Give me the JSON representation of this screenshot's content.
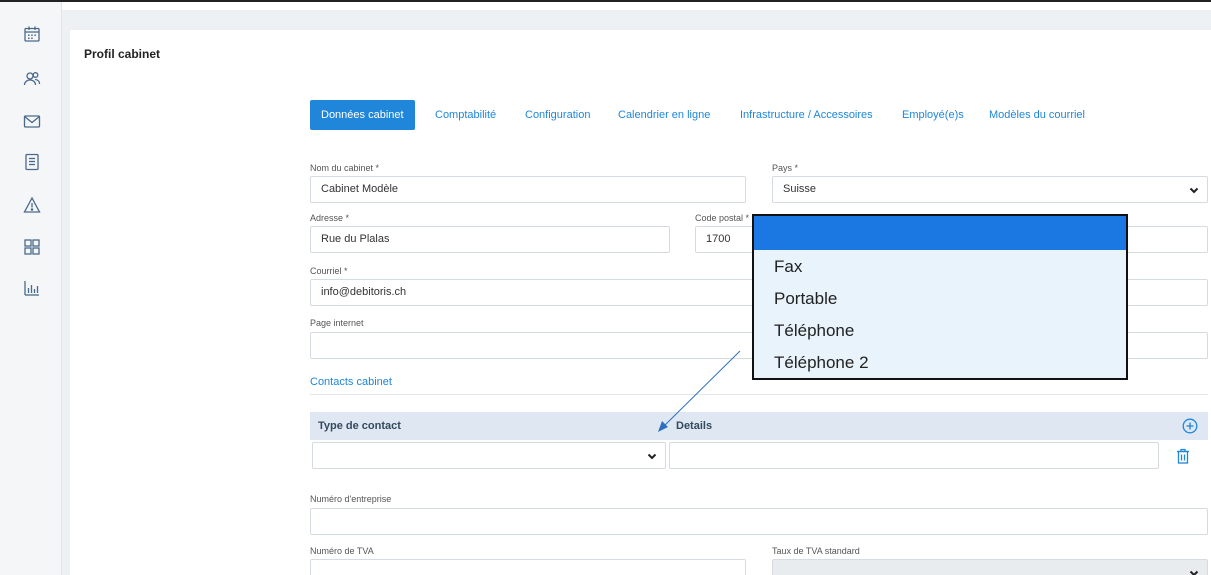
{
  "sidebar": {
    "icons": [
      "calendar-icon",
      "users-icon",
      "mail-icon",
      "document-icon",
      "warning-icon",
      "grid-icon",
      "chart-icon"
    ]
  },
  "page": {
    "title": "Profil cabinet"
  },
  "tabs": [
    {
      "label": "Données cabinet",
      "active": true
    },
    {
      "label": "Comptabilité",
      "active": false
    },
    {
      "label": "Configuration",
      "active": false
    },
    {
      "label": "Calendrier en ligne",
      "active": false
    },
    {
      "label": "Infrastructure / Accessoires",
      "active": false
    },
    {
      "label": "Employé(e)s",
      "active": false
    },
    {
      "label": "Modèles du courriel",
      "active": false
    }
  ],
  "form": {
    "nom_label": "Nom du cabinet *",
    "nom_value": "Cabinet Modèle",
    "pays_label": "Pays *",
    "pays_value": "Suisse",
    "adresse_label": "Adresse *",
    "adresse_value": "Rue du Plalas",
    "code_postal_label": "Code postal *",
    "code_postal_value": "1700",
    "courriel_label": "Courriel *",
    "courriel_value": "info@debitoris.ch",
    "page_internet_label": "Page internet",
    "page_internet_value": "",
    "contacts_title": "Contacts cabinet",
    "numero_entreprise_label": "Numéro d'entreprise",
    "numero_entreprise_value": "",
    "numero_tva_label": "Numéro de TVA",
    "numero_tva_value": "",
    "taux_tva_label": "Taux de TVA standard",
    "taux_tva_value": ""
  },
  "contacts_table": {
    "col_type": "Type de contact",
    "col_details": "Details",
    "row_type_value": "",
    "row_details_value": ""
  },
  "dropdown": {
    "options": [
      "",
      "Fax",
      "Portable",
      "Téléphone",
      "Téléphone 2"
    ],
    "selected_index": 0
  },
  "colors": {
    "accent": "#1f86d9",
    "dropdown_highlight": "#1b78e2",
    "dropdown_bg": "#e8f3fb",
    "table_header_bg": "#dfe8f2"
  }
}
